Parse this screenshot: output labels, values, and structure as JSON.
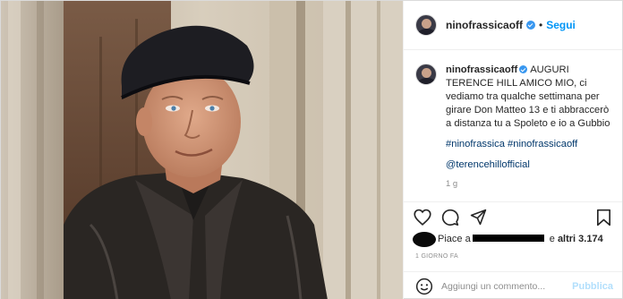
{
  "post": {
    "header": {
      "username": "ninofrassicaoff",
      "dot": "•",
      "follow_label": "Segui"
    },
    "caption": {
      "username": "ninofrassicaoff",
      "text": "AUGURI TERENCE HILL AMICO MIO, ci vediamo tra qualche settimana per girare Don Matteo 13 e ti abbraccerò a distanza tu a Spoleto e io a Gubbio",
      "hashtags": "#ninofrassica #ninofrassicaoff",
      "mention": "@terencehillofficial",
      "age": "1 g"
    },
    "likes": {
      "prefix": "Piace a",
      "suffix_pre": " e ",
      "others": "altri 3.174"
    },
    "date": "1 GIORNO FA",
    "comment": {
      "placeholder": "Aggiungi un commento...",
      "publish_label": "Pubblica"
    },
    "colors": {
      "accent": "#0095f6",
      "verified": "#3897f0",
      "publish_disabled": "#b2dffc"
    },
    "icons": {
      "like": "heart-icon",
      "comment": "comment-icon",
      "share": "paper-plane-icon",
      "save": "bookmark-icon",
      "emoji": "smiley-icon"
    }
  }
}
